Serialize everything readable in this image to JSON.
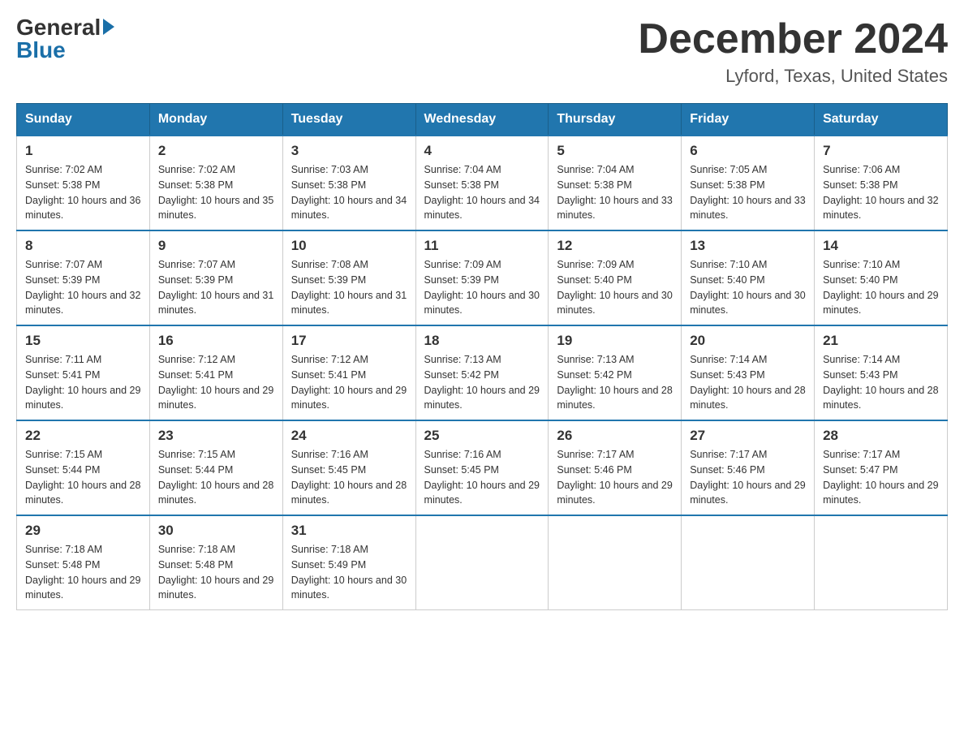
{
  "header": {
    "logo_general": "General",
    "logo_blue": "Blue",
    "month_title": "December 2024",
    "location": "Lyford, Texas, United States"
  },
  "weekdays": [
    "Sunday",
    "Monday",
    "Tuesday",
    "Wednesday",
    "Thursday",
    "Friday",
    "Saturday"
  ],
  "weeks": [
    [
      {
        "day": "1",
        "sunrise": "7:02 AM",
        "sunset": "5:38 PM",
        "daylight": "10 hours and 36 minutes."
      },
      {
        "day": "2",
        "sunrise": "7:02 AM",
        "sunset": "5:38 PM",
        "daylight": "10 hours and 35 minutes."
      },
      {
        "day": "3",
        "sunrise": "7:03 AM",
        "sunset": "5:38 PM",
        "daylight": "10 hours and 34 minutes."
      },
      {
        "day": "4",
        "sunrise": "7:04 AM",
        "sunset": "5:38 PM",
        "daylight": "10 hours and 34 minutes."
      },
      {
        "day": "5",
        "sunrise": "7:04 AM",
        "sunset": "5:38 PM",
        "daylight": "10 hours and 33 minutes."
      },
      {
        "day": "6",
        "sunrise": "7:05 AM",
        "sunset": "5:38 PM",
        "daylight": "10 hours and 33 minutes."
      },
      {
        "day": "7",
        "sunrise": "7:06 AM",
        "sunset": "5:38 PM",
        "daylight": "10 hours and 32 minutes."
      }
    ],
    [
      {
        "day": "8",
        "sunrise": "7:07 AM",
        "sunset": "5:39 PM",
        "daylight": "10 hours and 32 minutes."
      },
      {
        "day": "9",
        "sunrise": "7:07 AM",
        "sunset": "5:39 PM",
        "daylight": "10 hours and 31 minutes."
      },
      {
        "day": "10",
        "sunrise": "7:08 AM",
        "sunset": "5:39 PM",
        "daylight": "10 hours and 31 minutes."
      },
      {
        "day": "11",
        "sunrise": "7:09 AM",
        "sunset": "5:39 PM",
        "daylight": "10 hours and 30 minutes."
      },
      {
        "day": "12",
        "sunrise": "7:09 AM",
        "sunset": "5:40 PM",
        "daylight": "10 hours and 30 minutes."
      },
      {
        "day": "13",
        "sunrise": "7:10 AM",
        "sunset": "5:40 PM",
        "daylight": "10 hours and 30 minutes."
      },
      {
        "day": "14",
        "sunrise": "7:10 AM",
        "sunset": "5:40 PM",
        "daylight": "10 hours and 29 minutes."
      }
    ],
    [
      {
        "day": "15",
        "sunrise": "7:11 AM",
        "sunset": "5:41 PM",
        "daylight": "10 hours and 29 minutes."
      },
      {
        "day": "16",
        "sunrise": "7:12 AM",
        "sunset": "5:41 PM",
        "daylight": "10 hours and 29 minutes."
      },
      {
        "day": "17",
        "sunrise": "7:12 AM",
        "sunset": "5:41 PM",
        "daylight": "10 hours and 29 minutes."
      },
      {
        "day": "18",
        "sunrise": "7:13 AM",
        "sunset": "5:42 PM",
        "daylight": "10 hours and 29 minutes."
      },
      {
        "day": "19",
        "sunrise": "7:13 AM",
        "sunset": "5:42 PM",
        "daylight": "10 hours and 28 minutes."
      },
      {
        "day": "20",
        "sunrise": "7:14 AM",
        "sunset": "5:43 PM",
        "daylight": "10 hours and 28 minutes."
      },
      {
        "day": "21",
        "sunrise": "7:14 AM",
        "sunset": "5:43 PM",
        "daylight": "10 hours and 28 minutes."
      }
    ],
    [
      {
        "day": "22",
        "sunrise": "7:15 AM",
        "sunset": "5:44 PM",
        "daylight": "10 hours and 28 minutes."
      },
      {
        "day": "23",
        "sunrise": "7:15 AM",
        "sunset": "5:44 PM",
        "daylight": "10 hours and 28 minutes."
      },
      {
        "day": "24",
        "sunrise": "7:16 AM",
        "sunset": "5:45 PM",
        "daylight": "10 hours and 28 minutes."
      },
      {
        "day": "25",
        "sunrise": "7:16 AM",
        "sunset": "5:45 PM",
        "daylight": "10 hours and 29 minutes."
      },
      {
        "day": "26",
        "sunrise": "7:17 AM",
        "sunset": "5:46 PM",
        "daylight": "10 hours and 29 minutes."
      },
      {
        "day": "27",
        "sunrise": "7:17 AM",
        "sunset": "5:46 PM",
        "daylight": "10 hours and 29 minutes."
      },
      {
        "day": "28",
        "sunrise": "7:17 AM",
        "sunset": "5:47 PM",
        "daylight": "10 hours and 29 minutes."
      }
    ],
    [
      {
        "day": "29",
        "sunrise": "7:18 AM",
        "sunset": "5:48 PM",
        "daylight": "10 hours and 29 minutes."
      },
      {
        "day": "30",
        "sunrise": "7:18 AM",
        "sunset": "5:48 PM",
        "daylight": "10 hours and 29 minutes."
      },
      {
        "day": "31",
        "sunrise": "7:18 AM",
        "sunset": "5:49 PM",
        "daylight": "10 hours and 30 minutes."
      },
      null,
      null,
      null,
      null
    ]
  ]
}
